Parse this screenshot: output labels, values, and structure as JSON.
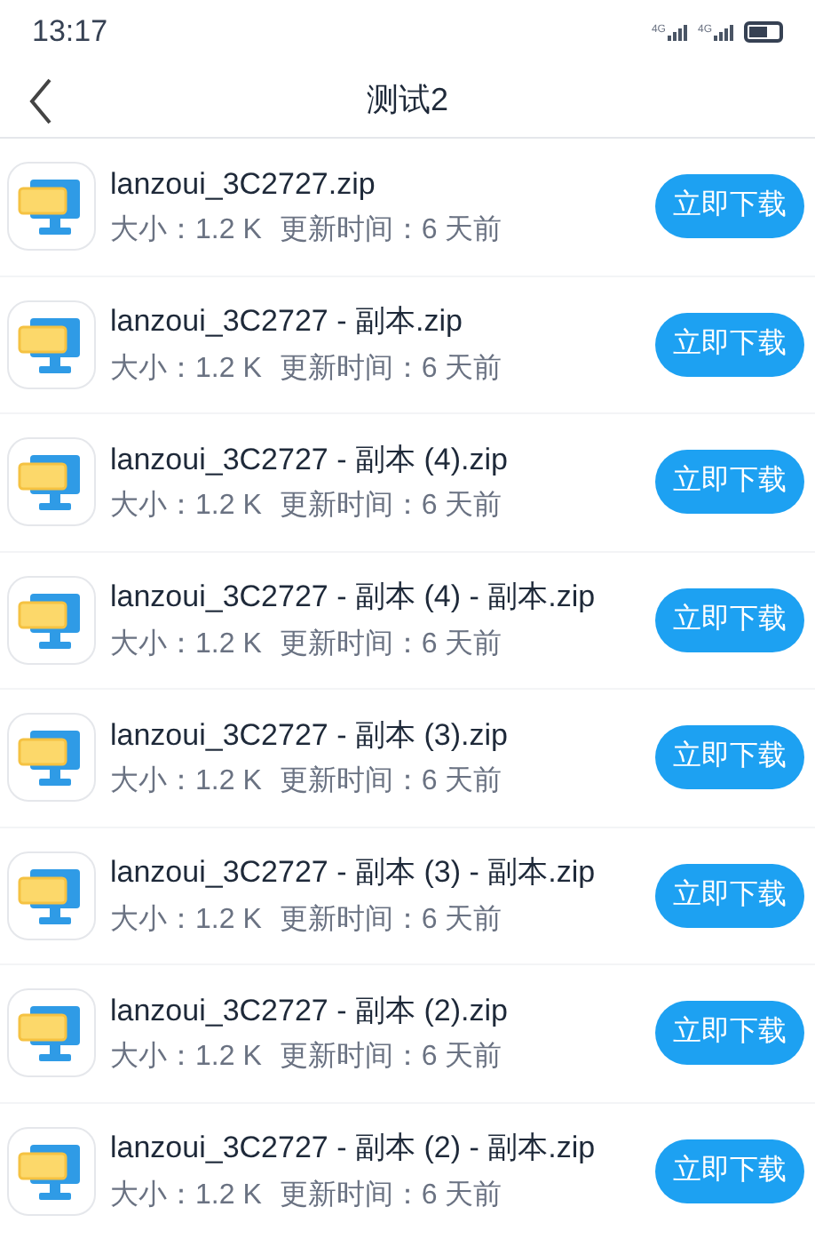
{
  "status_bar": {
    "time": "13:17",
    "signal_1": "4G",
    "signal_2": "4G"
  },
  "nav": {
    "title": "测试2"
  },
  "files": [
    {
      "name": "lanzoui_3C2727.zip",
      "size": "大小：1.2 K",
      "updated": "更新时间：6 天前",
      "action": "立即下载"
    },
    {
      "name": "lanzoui_3C2727 - 副本.zip",
      "size": "大小：1.2 K",
      "updated": "更新时间：6 天前",
      "action": "立即下载"
    },
    {
      "name": "lanzoui_3C2727 - 副本 (4).zip",
      "size": "大小：1.2 K",
      "updated": "更新时间：6 天前",
      "action": "立即下载"
    },
    {
      "name": "lanzoui_3C2727 - 副本 (4) - 副本.zip",
      "size": "大小：1.2 K",
      "updated": "更新时间：6 天前",
      "action": "立即下载"
    },
    {
      "name": "lanzoui_3C2727 - 副本 (3).zip",
      "size": "大小：1.2 K",
      "updated": "更新时间：6 天前",
      "action": "立即下载"
    },
    {
      "name": "lanzoui_3C2727 - 副本 (3) - 副本.zip",
      "size": "大小：1.2 K",
      "updated": "更新时间：6 天前",
      "action": "立即下载"
    },
    {
      "name": "lanzoui_3C2727 - 副本 (2).zip",
      "size": "大小：1.2 K",
      "updated": "更新时间：6 天前",
      "action": "立即下载"
    },
    {
      "name": "lanzoui_3C2727 - 副本 (2) - 副本.zip",
      "size": "大小：1.2 K",
      "updated": "更新时间：6 天前",
      "action": "立即下载"
    }
  ]
}
